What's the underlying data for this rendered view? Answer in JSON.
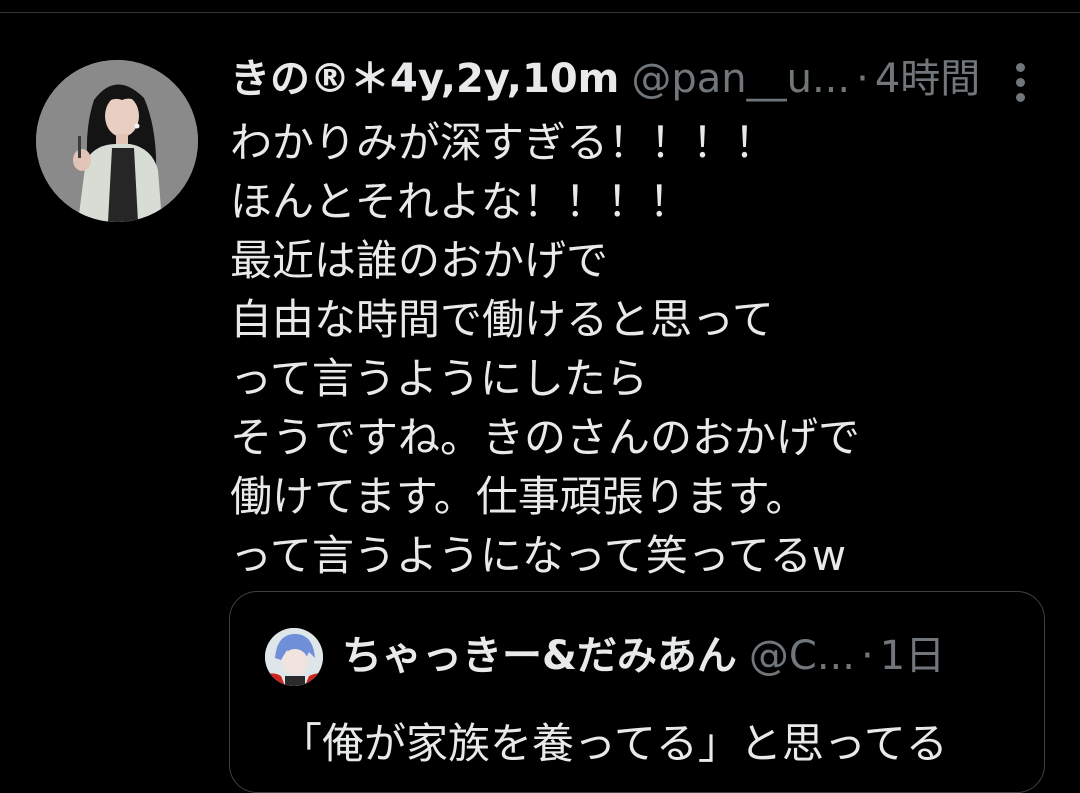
{
  "tweet": {
    "display_name": "きの®＊4y,2y,10m",
    "handle": "@pan__u...",
    "separator": "·",
    "time": "4時間",
    "text_lines": [
      "わかりみが深すぎる！！！！",
      "ほんとそれよな！！！！",
      "最近は誰のおかげで",
      "自由な時間で働けると思って",
      "って言うようにしたら",
      "そうですね。きのさんのおかげで",
      "働けてます。仕事頑張ります。",
      "って言うようになって笑ってるw"
    ]
  },
  "quote": {
    "display_name": "ちゃっきー&だみあん",
    "handle": "@C...",
    "separator": "·",
    "time": "1日",
    "text_first_line": "「俺が家族を養ってる」と思ってる"
  },
  "icons": {
    "more": "more-vertical-icon",
    "avatar": "user-avatar",
    "quote_avatar": "quoted-user-avatar"
  },
  "colors": {
    "background": "#000000",
    "text_primary": "#e7e9ea",
    "text_secondary": "#71767b",
    "border": "#3e4144"
  }
}
